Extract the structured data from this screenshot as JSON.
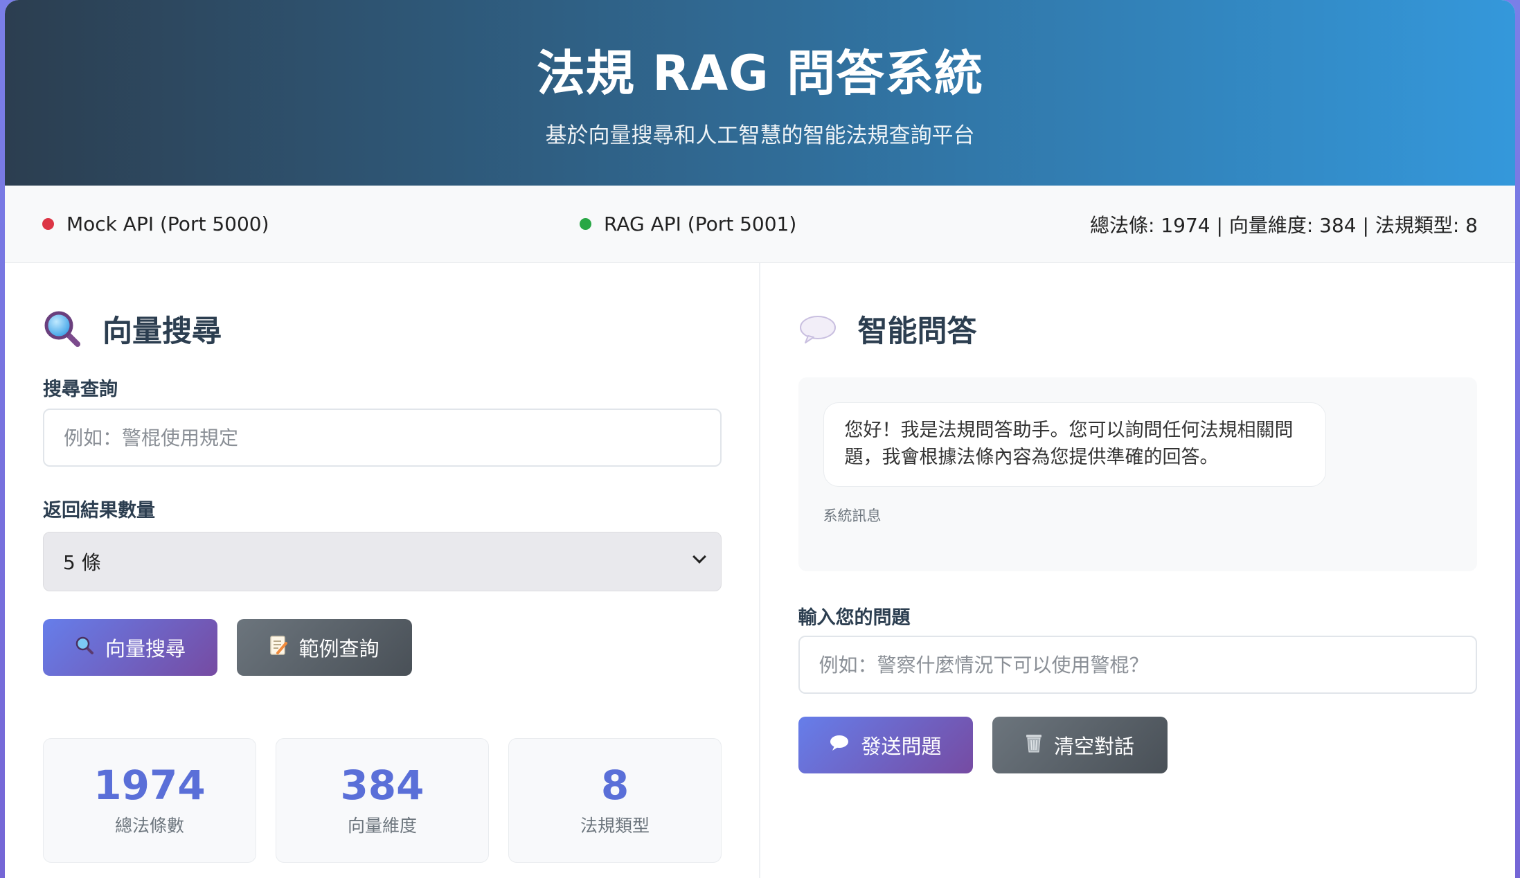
{
  "header": {
    "title": "法規 RAG 問答系統",
    "subtitle": "基於向量搜尋和人工智慧的智能法規查詢平台"
  },
  "status": {
    "mock_api": {
      "label": "Mock API (Port 5000)",
      "color": "#dc3545"
    },
    "rag_api": {
      "label": "RAG API (Port 5001)",
      "color": "#28a745"
    },
    "stats_text": "總法條: 1974 | 向量維度: 384 | 法規類型: 8"
  },
  "search_panel": {
    "title": "向量搜尋",
    "title_icon": "magnifier-icon",
    "query_label": "搜尋查詢",
    "query_placeholder": "例如：警棍使用規定",
    "query_value": "",
    "count_label": "返回結果數量",
    "count_selected": "5 條",
    "search_button": "向量搜尋",
    "search_button_icon": "magnifier-icon",
    "example_button": "範例查詢",
    "example_button_icon": "memo-icon",
    "stats": [
      {
        "value": "1974",
        "caption": "總法條數"
      },
      {
        "value": "384",
        "caption": "向量維度"
      },
      {
        "value": "8",
        "caption": "法規類型"
      }
    ]
  },
  "qa_panel": {
    "title": "智能問答",
    "title_icon": "speech-bubble-icon",
    "messages": [
      {
        "text": "您好！我是法規問答助手。您可以詢問任何法規相關問題，我會根據法條內容為您提供準確的回答。",
        "meta": "系統訊息"
      }
    ],
    "input_label": "輸入您的問題",
    "input_placeholder": "例如：警察什麼情況下可以使用警棍？",
    "input_value": "",
    "send_button": "發送問題",
    "send_button_icon": "speech-bubble-icon",
    "clear_button": "清空對話",
    "clear_button_icon": "wastebasket-icon"
  },
  "colors": {
    "accent_gradient_start": "#667eea",
    "accent_gradient_end": "#764ba2",
    "header_gradient_start": "#2c3e50",
    "header_gradient_end": "#3498db",
    "stat_number": "#5a6fd8"
  }
}
